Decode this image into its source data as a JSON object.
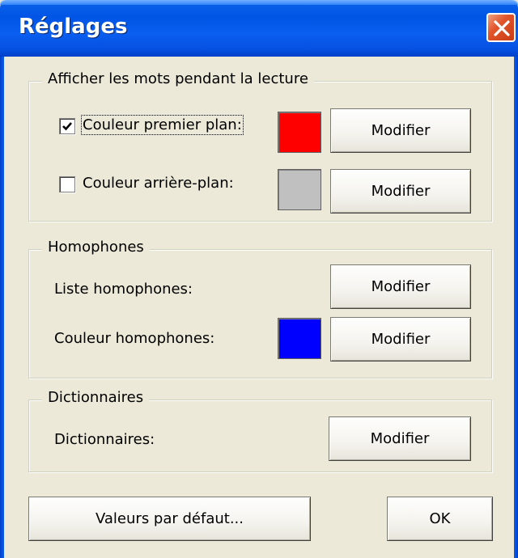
{
  "window": {
    "title": "Réglages"
  },
  "display_group": {
    "legend": "Afficher les mots pendant la lecture",
    "foreground": {
      "label": "Couleur premier plan:",
      "checked": true,
      "color": "#ff0000",
      "button": "Modifier"
    },
    "background": {
      "label": "Couleur arrière-plan:",
      "checked": false,
      "color": "#c0c0c0",
      "button": "Modifier"
    }
  },
  "homophones_group": {
    "legend": "Homophones",
    "list": {
      "label": "Liste homophones:",
      "button": "Modifier"
    },
    "color": {
      "label": "Couleur homophones:",
      "color": "#0000ff",
      "button": "Modifier"
    }
  },
  "dictionaries_group": {
    "legend": "Dictionnaires",
    "dict": {
      "label": "Dictionnaires:",
      "button": "Modifier"
    }
  },
  "footer": {
    "defaults_button": "Valeurs par défaut...",
    "ok_button": "OK"
  },
  "icons": {
    "close": "close-icon",
    "check": "checkmark-icon"
  }
}
